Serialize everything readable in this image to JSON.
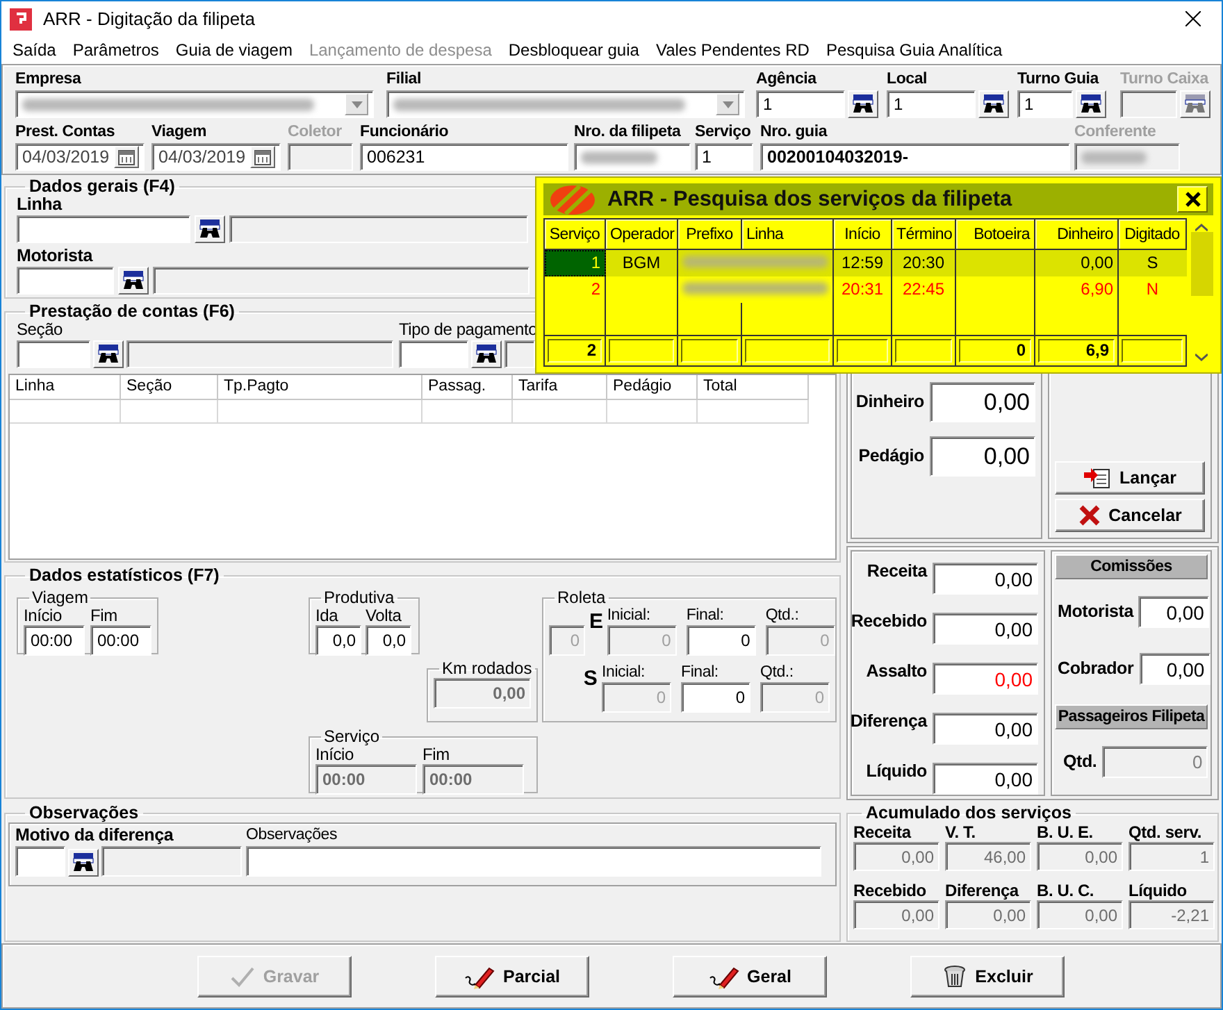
{
  "window": {
    "title": "ARR - Digitação da filipeta"
  },
  "menu": [
    {
      "label": "Saída",
      "disabled": false
    },
    {
      "label": "Parâmetros",
      "disabled": false
    },
    {
      "label": "Guia de viagem",
      "disabled": false
    },
    {
      "label": "Lançamento de despesa",
      "disabled": true
    },
    {
      "label": "Desbloquear guia",
      "disabled": false
    },
    {
      "label": "Vales Pendentes RD",
      "disabled": false
    },
    {
      "label": "Pesquisa Guia Analítica",
      "disabled": false
    }
  ],
  "header_row_1": [
    {
      "label": "Empresa",
      "kind": "combo",
      "redacted": true,
      "disabled": false
    },
    {
      "label": "Filial",
      "kind": "combo",
      "redacted": true,
      "disabled": false
    },
    {
      "label": "Agência",
      "kind": "lookup",
      "value": "1",
      "disabled": false
    },
    {
      "label": "Local",
      "kind": "lookup",
      "value": "1",
      "disabled": false
    },
    {
      "label": "Turno Guia",
      "kind": "lookup",
      "value": "1",
      "disabled": false
    },
    {
      "label": "Turno Caixa",
      "kind": "lookup",
      "disabled": true
    }
  ],
  "header_row_2": [
    {
      "label": "Prest. Contas",
      "kind": "date",
      "value": "04/03/2019",
      "disabled": false
    },
    {
      "label": "Viagem",
      "kind": "date",
      "value": "04/03/2019",
      "disabled": false
    },
    {
      "label": "Coletor",
      "kind": "text",
      "disabled": true
    },
    {
      "label": "Funcionário",
      "kind": "text",
      "value": "006231",
      "disabled": false
    },
    {
      "label": "Nro. da filipeta",
      "kind": "text",
      "redacted": true,
      "disabled": false
    },
    {
      "label": "Serviço",
      "kind": "text",
      "value": "1",
      "disabled": false
    },
    {
      "label": "Nro. guia",
      "kind": "text",
      "value": "00200104032019-",
      "disabled": false
    },
    {
      "label": "Conferente",
      "kind": "text",
      "redacted": true,
      "disabled": true
    }
  ],
  "dados_gerais": {
    "title": "Dados gerais (F4)",
    "fields": [
      {
        "label": "Linha"
      },
      {
        "label": "Motorista"
      }
    ]
  },
  "prestacao": {
    "title": "Prestação de contas (F6)",
    "fields": [
      {
        "label": "Seção"
      },
      {
        "label": "Tipo de pagamento"
      }
    ],
    "columns": [
      "Linha",
      "Seção",
      "Tp.Pagto",
      "Passag.",
      "Tarifa",
      "Pedágio",
      "Total"
    ]
  },
  "estatisticos": {
    "title": "Dados estatísticos (F7)",
    "viagem": {
      "title": "Viagem",
      "fields": [
        {
          "label": "Início",
          "value": "00:00",
          "disabled": false
        },
        {
          "label": "Fim",
          "value": "00:00",
          "disabled": false
        }
      ]
    },
    "produtiva": {
      "title": "Produtiva",
      "fields": [
        {
          "label": "Ida",
          "value": "0,0",
          "disabled": false
        },
        {
          "label": "Volta",
          "value": "0,0",
          "disabled": false
        }
      ]
    },
    "km_rodados": {
      "title": "Km rodados",
      "value": "0,00",
      "disabled": true
    },
    "servico": {
      "title": "Serviço",
      "fields": [
        {
          "label": "Início",
          "value": "00:00",
          "disabled": true
        },
        {
          "label": "Fim",
          "value": "00:00",
          "disabled": true
        }
      ]
    },
    "roleta": {
      "title": "Roleta",
      "value": "0",
      "disabled": true,
      "rows": [
        {
          "label": "E",
          "fields": [
            {
              "label": "Inicial:",
              "value": "0",
              "disabled": true
            },
            {
              "label": "Final:",
              "value": "0",
              "disabled": false
            },
            {
              "label": "Qtd.:",
              "value": "0",
              "disabled": true
            }
          ]
        },
        {
          "label": "S",
          "fields": [
            {
              "label": "Inicial:",
              "value": "0",
              "disabled": true
            },
            {
              "label": "Final:",
              "value": "0",
              "disabled": false
            },
            {
              "label": "Qtd.:",
              "value": "0",
              "disabled": true
            }
          ]
        }
      ]
    }
  },
  "valores": {
    "fields": [
      {
        "label": "Dinheiro",
        "value": "0,00"
      },
      {
        "label": "Pedágio",
        "value": "0,00"
      }
    ],
    "buttons": [
      {
        "label": "Lançar",
        "kind": "add"
      },
      {
        "label": "Cancelar",
        "kind": "cancel"
      }
    ]
  },
  "totais": [
    {
      "label": "Receita",
      "value": "0,00",
      "alert": false
    },
    {
      "label": "Recebido",
      "value": "0,00",
      "alert": false
    },
    {
      "label": "Assalto",
      "value": "0,00",
      "alert": true
    },
    {
      "label": "Diferença",
      "value": "0,00",
      "alert": false
    },
    {
      "label": "Líquido",
      "value": "0,00",
      "alert": false
    }
  ],
  "comissoes": {
    "title": "Comissões",
    "fields": [
      {
        "label": "Motorista",
        "value": "0,00"
      },
      {
        "label": "Cobrador",
        "value": "0,00"
      }
    ]
  },
  "passageiros": {
    "title": "Passageiros Filipeta",
    "label": "Qtd.",
    "value": "0"
  },
  "observacoes": {
    "title": "Observações",
    "motivo_label": "Motivo da diferença",
    "obs_label": "Observações"
  },
  "acumulado": {
    "title": "Acumulado dos serviços",
    "fields": [
      {
        "label": "Receita",
        "value": "0,00"
      },
      {
        "label": "V. T.",
        "value": "46,00"
      },
      {
        "label": "B. U. E.",
        "value": "0,00"
      },
      {
        "label": "Qtd. serv.",
        "value": "1"
      },
      {
        "label": "Recebido",
        "value": "0,00"
      },
      {
        "label": "Diferença",
        "value": "0,00"
      },
      {
        "label": "B. U. C.",
        "value": "0,00"
      },
      {
        "label": "Líquido",
        "value": "-2,21"
      }
    ]
  },
  "buttons": [
    {
      "label": "Gravar",
      "kind": "save",
      "disabled": true
    },
    {
      "label": "Parcial",
      "kind": "report",
      "disabled": false
    },
    {
      "label": "Geral",
      "kind": "report",
      "disabled": false
    },
    {
      "label": "Excluir",
      "kind": "delete",
      "disabled": false
    }
  ],
  "popup": {
    "title": "ARR - Pesquisa dos serviços da filipeta",
    "columns": [
      "Serviço",
      "Operador",
      "Prefixo",
      "Linha",
      "Início",
      "Término",
      "Botoeira",
      "Dinheiro",
      "Digitado"
    ],
    "rows": [
      {
        "servico": "1",
        "operador": "BGM",
        "inicio": "12:59",
        "termino": "20:30",
        "dinheiro": "0,00",
        "digitado": "S",
        "redacted": true,
        "selected": true,
        "pending": false
      },
      {
        "servico": "2",
        "inicio": "20:31",
        "termino": "22:45",
        "dinheiro": "6,90",
        "digitado": "N",
        "redacted": true,
        "selected": false,
        "pending": true
      }
    ],
    "footer": {
      "servico": "2",
      "botoeira": "0",
      "dinheiro": "6,9"
    }
  }
}
